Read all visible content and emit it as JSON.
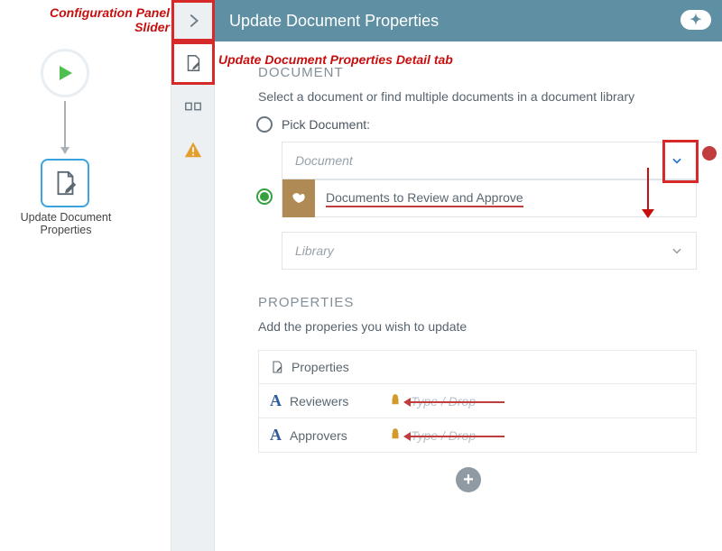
{
  "annotations": {
    "slider": "Configuration Panel Slider",
    "detail_tab": "Update Document Properties Detail tab"
  },
  "canvas": {
    "node_label": "Update Document Properties"
  },
  "header": {
    "title": "Update Document Properties"
  },
  "document_section": {
    "title": "DOCUMENT",
    "help": "Select a document or find multiple documents in a document library",
    "radio_pick": "Pick Document:",
    "dd_document_placeholder": "Document",
    "selected_doc": "Documents to Review and Approve",
    "dd_library_placeholder": "Library"
  },
  "properties_section": {
    "title": "PROPERTIES",
    "help": "Add the properies you wish to update",
    "table_header": "Properties",
    "rows": [
      {
        "name": "Reviewers",
        "placeholder": "Type / Drop"
      },
      {
        "name": "Approvers",
        "placeholder": "Type / Drop"
      }
    ]
  }
}
